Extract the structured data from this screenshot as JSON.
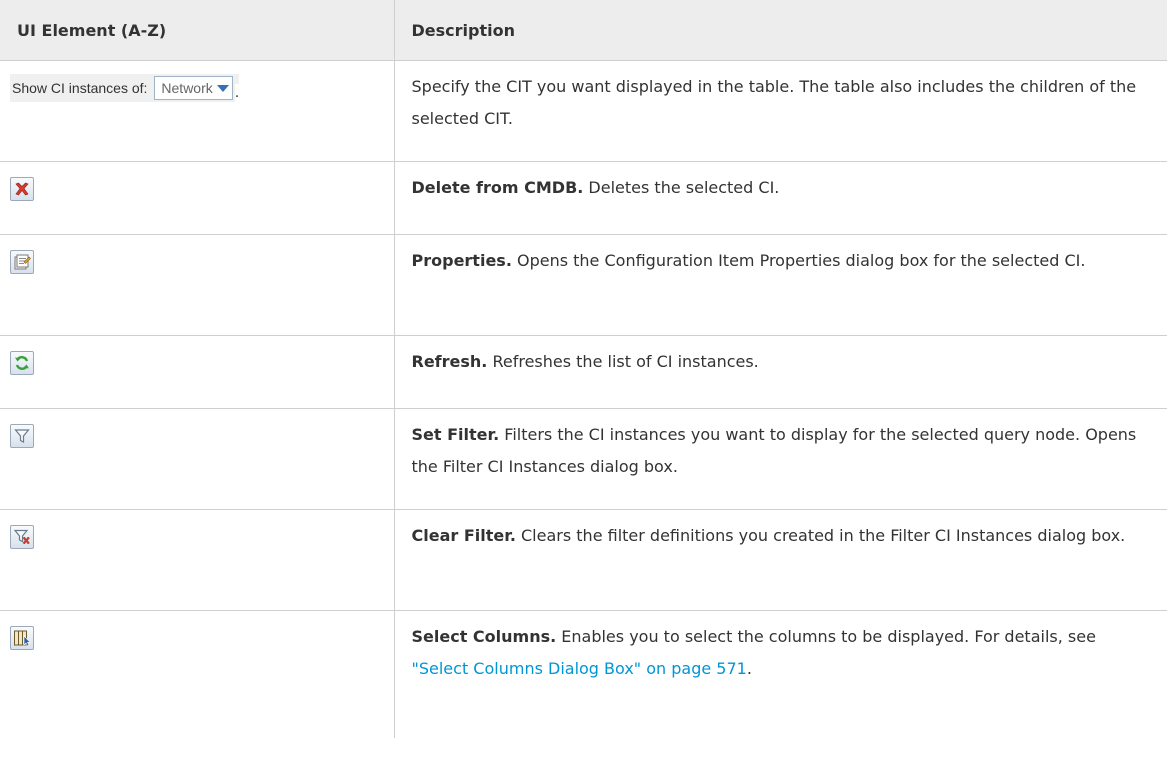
{
  "table": {
    "header": {
      "element": "UI Element (A-Z)",
      "description": "Description"
    },
    "rows": [
      {
        "element_label": "Show CI instances of:",
        "element_value": "Network",
        "element_trailing": ".",
        "title": "",
        "text": "Specify the CIT you want displayed in the table. The table also includes the children of the selected CIT."
      },
      {
        "icon": "delete-icon",
        "title": "Delete from CMDB.",
        "text": " Deletes the selected CI."
      },
      {
        "icon": "properties-icon",
        "title": "Properties.",
        "text": " Opens the Configuration Item Properties dialog box for the selected CI."
      },
      {
        "icon": "refresh-icon",
        "title": "Refresh.",
        "text": " Refreshes the list of CI instances."
      },
      {
        "icon": "filter-icon",
        "title": "Set Filter.",
        "text": " Filters the CI instances you want to display for the selected query node. Opens the Filter CI Instances dialog box."
      },
      {
        "icon": "clear-filter-icon",
        "title": "Clear Filter.",
        "text": " Clears the filter definitions you created in the Filter CI Instances dialog box."
      },
      {
        "icon": "select-columns-icon",
        "title": "Select Columns.",
        "text": " Enables you to select the columns to be displayed. For details, see ",
        "link": "\"Select Columns Dialog Box\" on page 571",
        "text_after": "."
      }
    ]
  },
  "colors": {
    "header_bg": "#ededed",
    "border": "#cfcfcf",
    "link": "#0096d6",
    "delete_red": "#d83a2e",
    "refresh_green": "#3aa13a"
  }
}
